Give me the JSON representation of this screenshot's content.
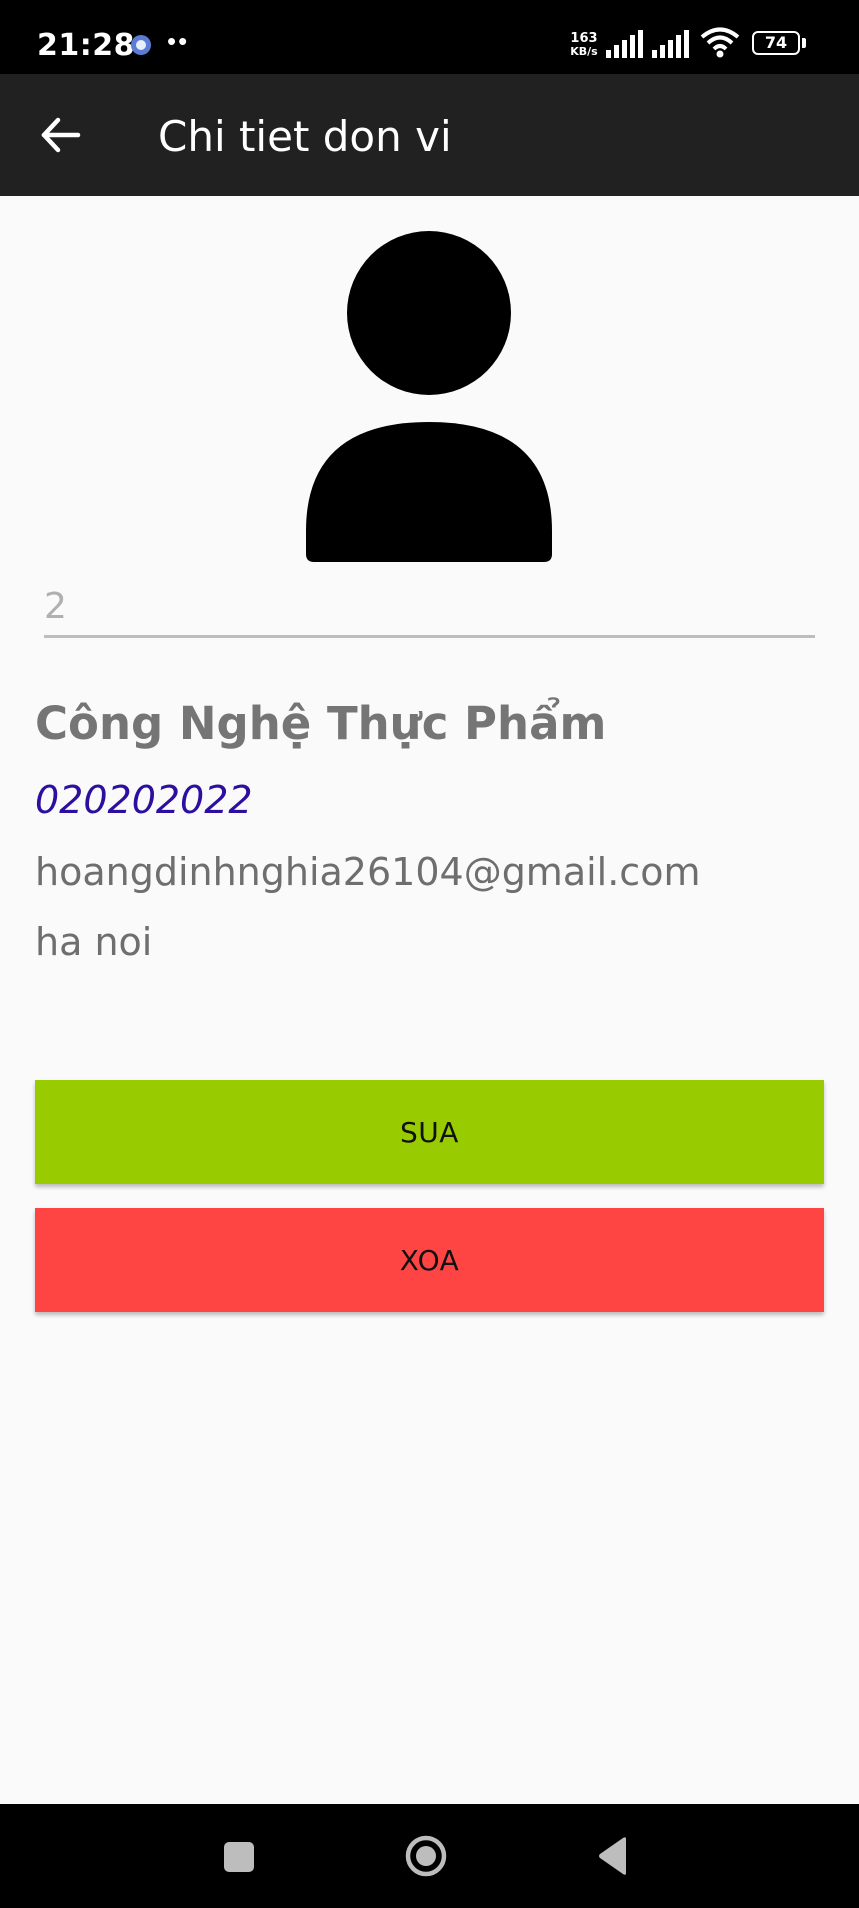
{
  "status_bar": {
    "time": "21:28",
    "dots": "••",
    "net_speed_value": "163",
    "net_speed_unit": "KB/s",
    "battery": "74",
    "icons": [
      "notification-icon",
      "signal-icon",
      "signal-icon",
      "wifi-icon",
      "battery-icon"
    ]
  },
  "app_bar": {
    "title": "Chi tiet don vi",
    "back_icon": "arrow-back-icon"
  },
  "detail": {
    "avatar_icon": "person-icon",
    "id_value": "2",
    "name": "Công Nghệ Thực Phẩm",
    "phone": "020202022",
    "email": "hoangdinhnghia26104@gmail.com",
    "address": "ha noi"
  },
  "actions": {
    "edit_label": "SUA",
    "delete_label": "XOA"
  },
  "colors": {
    "app_bar": "#212121",
    "edit_button": "#99cc00",
    "delete_button": "#ff4444",
    "phone_text": "#2d0e9e"
  },
  "nav_bar": {
    "icons": [
      "recents-icon",
      "home-icon",
      "back-icon"
    ]
  }
}
